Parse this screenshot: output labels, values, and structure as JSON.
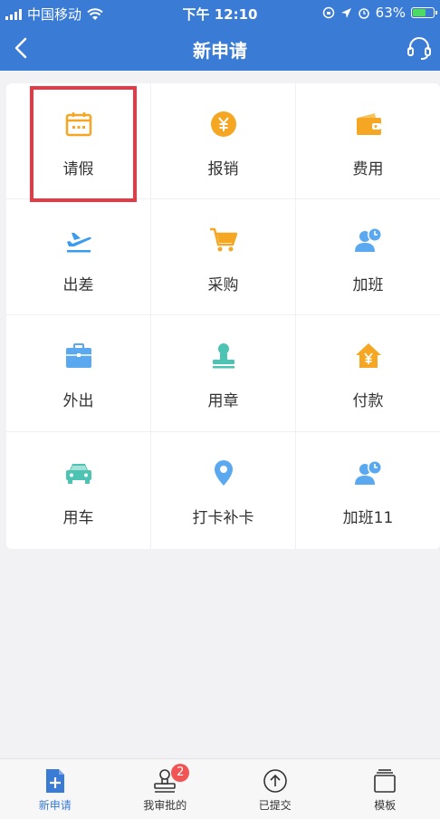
{
  "status": {
    "carrier": "中国移动",
    "time": "下午 12:10",
    "battery": "63%"
  },
  "nav": {
    "title": "新申请"
  },
  "grid": {
    "items": [
      {
        "label": "请假",
        "icon": "calendar-icon",
        "color": "#f5a623"
      },
      {
        "label": "报销",
        "icon": "yen-coin-icon",
        "color": "#f5a623"
      },
      {
        "label": "费用",
        "icon": "wallet-icon",
        "color": "#f5a623"
      },
      {
        "label": "出差",
        "icon": "airplane-icon",
        "color": "#3a9bef"
      },
      {
        "label": "采购",
        "icon": "shopping-cart-icon",
        "color": "#f5a623"
      },
      {
        "label": "加班",
        "icon": "user-clock-icon",
        "color": "#5aa8f0"
      },
      {
        "label": "外出",
        "icon": "briefcase-icon",
        "color": "#5aa8f0"
      },
      {
        "label": "用章",
        "icon": "stamp-icon",
        "color": "#4cc3b3"
      },
      {
        "label": "付款",
        "icon": "house-yen-icon",
        "color": "#f5a623"
      },
      {
        "label": "用车",
        "icon": "car-icon",
        "color": "#4cc3b3"
      },
      {
        "label": "打卡补卡",
        "icon": "location-pin-icon",
        "color": "#5aa8f0"
      },
      {
        "label": "加班11",
        "icon": "user-clock-icon",
        "color": "#5aa8f0"
      }
    ]
  },
  "tabs": [
    {
      "label": "新申请",
      "icon": "new-doc-icon",
      "active": true
    },
    {
      "label": "我审批的",
      "icon": "approve-stamp-icon",
      "badge": "2"
    },
    {
      "label": "已提交",
      "icon": "upload-circle-icon"
    },
    {
      "label": "模板",
      "icon": "template-stack-icon"
    }
  ],
  "colors": {
    "primary": "#3a7bd5",
    "highlight": "#e63946",
    "badge": "#f05454"
  }
}
